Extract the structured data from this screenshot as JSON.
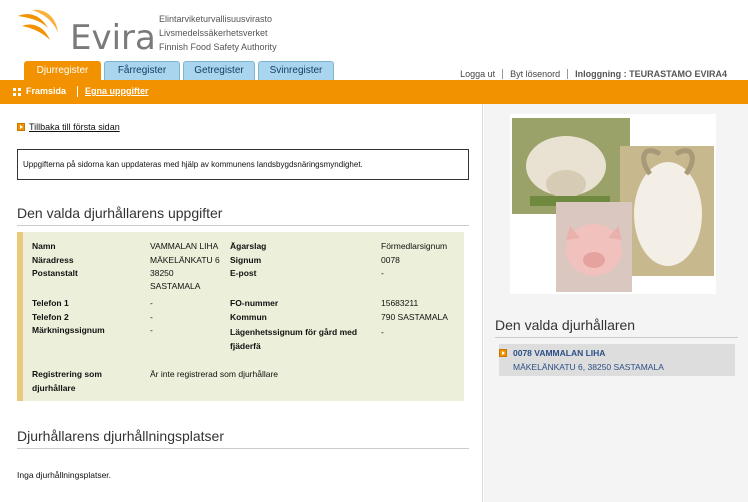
{
  "header": {
    "logo_text": "Evira",
    "agency_lines": [
      "Elintarviketurvallisuusvirasto",
      "Livsmedelssäkerhetsverket",
      "Finnish Food Safety Authority"
    ],
    "tabs": [
      {
        "label": "Djurregister"
      },
      {
        "label": "Fårregister"
      },
      {
        "label": "Getregister"
      },
      {
        "label": "Svinregister"
      }
    ],
    "links": {
      "logout": "Logga ut",
      "change_password": "Byt lösenord",
      "login_info": "Inloggning : TEURASTAMO EVIRA4"
    }
  },
  "nav": {
    "home": "Framsida",
    "own_tasks": "Egna uppgifter"
  },
  "main": {
    "back_link": "Tillbaka till första sidan",
    "notice": "Uppgifterna på sidorna kan uppdateras med hjälp av kommunens landsbygdsnäringsmyndighet.",
    "section1_title": "Den valda djurhållarens uppgifter",
    "fields": {
      "name_label": "Namn",
      "name_value": "VAMMALAN LIHA",
      "address_label": "Näradress",
      "address_value": "MÄKELÄNKATU 6",
      "post_label": "Postanstalt",
      "post_value": "38250",
      "post_value2": "SASTAMALA",
      "phone1_label": "Telefon 1",
      "phone1_value": "-",
      "phone2_label": "Telefon 2",
      "phone2_value": "-",
      "mark_label": "Märkningssignum",
      "mark_value": "-",
      "owner_type_label": "Ägarslag",
      "owner_type_value": "Förmedlarsignum",
      "signum_label": "Signum",
      "signum_value": "0078",
      "email_label": "E-post",
      "email_value": "-",
      "fo_label": "FO-nummer",
      "fo_value": "15683211",
      "municipality_label": "Kommun",
      "municipality_value": "790 SASTAMALA",
      "herd_label_1": "Lägenhetssignum för gård med",
      "herd_label_2": "fjäderfä",
      "herd_value": "-",
      "reg_label_1": "Registrering som",
      "reg_label_2": "djurhållare",
      "reg_value": "Är inte registrerad som djurhållare"
    },
    "section2_title": "Djurhållarens djurhållningsplatser",
    "empty_text": "Inga djurhållningsplatser."
  },
  "side": {
    "title": "Den valda djurhållaren",
    "holder_line1_id": "0078",
    "holder_line1_name": "VAMMALAN LIHA",
    "holder_line2": "MÄKELÄNKATU 6, 38250 SASTAMALA"
  },
  "colors": {
    "accent": "#f39200",
    "tab_inactive": "#a9d6ee",
    "infobox": "#ecefd9",
    "link": "#2b4f86"
  }
}
